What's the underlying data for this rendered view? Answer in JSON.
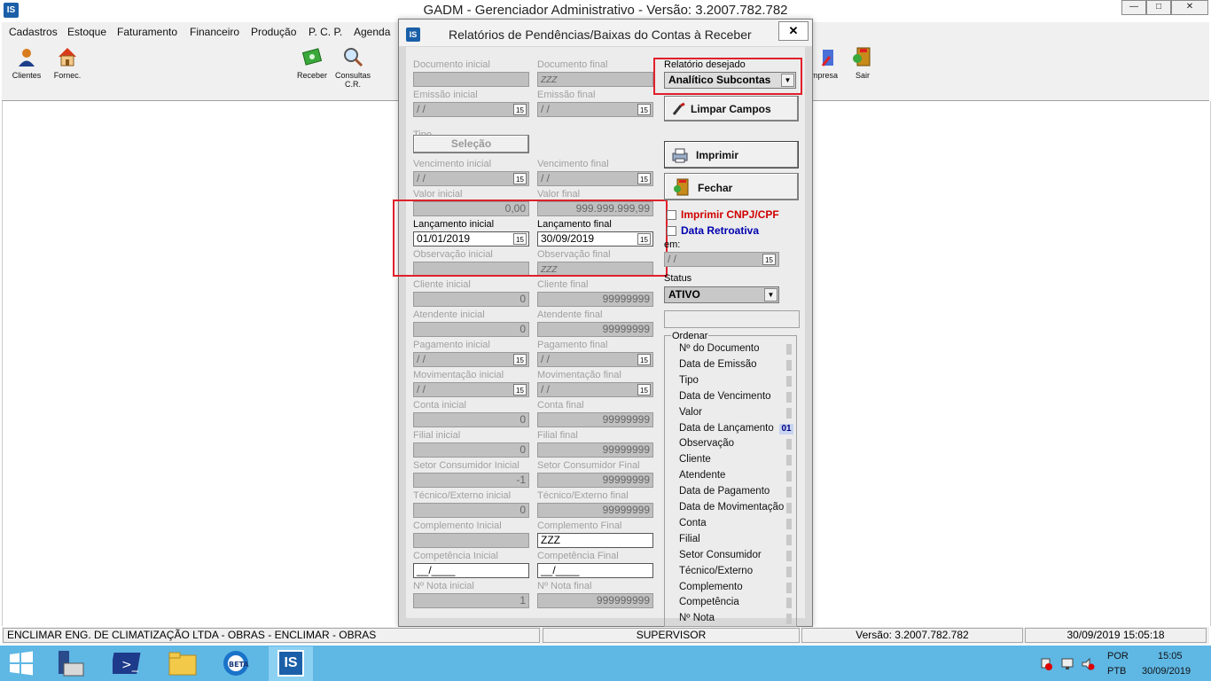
{
  "window": {
    "title": "GADM - Gerenciador Administrativo - Versão: 3.2007.782.782",
    "icon": "is-logo-icon",
    "controls": [
      "minimize-icon",
      "maximize-icon",
      "close-icon"
    ]
  },
  "menu": [
    "Cadastros",
    "Estoque",
    "Faturamento",
    "Financeiro",
    "Produção",
    "P. C. P.",
    "Agenda"
  ],
  "toolbar": [
    {
      "label": "Clientes",
      "icon": "person-icon"
    },
    {
      "label": "Fornec.",
      "icon": "house-icon"
    },
    {
      "label": "Receber",
      "icon": "money-icon"
    },
    {
      "label": "Consultas C.R.",
      "icon": "magnifier-icon"
    },
    {
      "label": "mpresa",
      "icon": "company-icon"
    },
    {
      "label": "Sair",
      "icon": "exit-icon"
    }
  ],
  "dialog": {
    "title": "Relatórios de Pendências/Baixas do Contas à Receber",
    "fields": {
      "doc_ini": {
        "label": "Documento inicial",
        "value": ""
      },
      "doc_fim": {
        "label": "Documento final",
        "value": "ZZZ"
      },
      "emi_ini": {
        "label": "Emissão inicial",
        "value": "/ /"
      },
      "emi_fim": {
        "label": "Emissão final",
        "value": "/ /"
      },
      "tipo": {
        "label": "Tipo",
        "button": "Seleção"
      },
      "venc_ini": {
        "label": "Vencimento inicial",
        "value": "/ /"
      },
      "venc_fim": {
        "label": "Vencimento final",
        "value": "/ /"
      },
      "val_ini": {
        "label": "Valor inicial",
        "value": "0,00"
      },
      "val_fim": {
        "label": "Valor final",
        "value": "999.999.999,99"
      },
      "lanc_ini": {
        "label": "Lançamento inicial",
        "value": "01/01/2019"
      },
      "lanc_fim": {
        "label": "Lançamento final",
        "value": "30/09/2019"
      },
      "obs_ini": {
        "label": "Observação inicial",
        "value": ""
      },
      "obs_fim": {
        "label": "Observação final",
        "value": "ZZZ"
      },
      "cli_ini": {
        "label": "Cliente inicial",
        "value": "0"
      },
      "cli_fim": {
        "label": "Cliente final",
        "value": "99999999"
      },
      "ate_ini": {
        "label": "Atendente inicial",
        "value": "0"
      },
      "ate_fim": {
        "label": "Atendente final",
        "value": "99999999"
      },
      "pag_ini": {
        "label": "Pagamento inicial",
        "value": "/ /"
      },
      "pag_fim": {
        "label": "Pagamento final",
        "value": "/ /"
      },
      "mov_ini": {
        "label": "Movimentação inicial",
        "value": "/ /"
      },
      "mov_fim": {
        "label": "Movimentação final",
        "value": "/ /"
      },
      "con_ini": {
        "label": "Conta inicial",
        "value": "0"
      },
      "con_fim": {
        "label": "Conta final",
        "value": "99999999"
      },
      "fil_ini": {
        "label": "Filial inicial",
        "value": "0"
      },
      "fil_fim": {
        "label": "Filial final",
        "value": "99999999"
      },
      "set_ini": {
        "label": "Setor Consumidor Inicial",
        "value": "-1"
      },
      "set_fim": {
        "label": "Setor Consumidor Final",
        "value": "99999999"
      },
      "tec_ini": {
        "label": "Técnico/Externo inicial",
        "value": "0"
      },
      "tec_fim": {
        "label": "Técnico/Externo final",
        "value": "99999999"
      },
      "comp_ini": {
        "label": "Complemento Inicial",
        "value": ""
      },
      "comp_fim": {
        "label": "Complemento Final",
        "value": "ZZZ"
      },
      "compt_ini": {
        "label": "Competência Inicial",
        "value": "__/____"
      },
      "compt_fim": {
        "label": "Competência Final",
        "value": "__/____"
      },
      "nota_ini": {
        "label": "Nº Nota inicial",
        "value": "1"
      },
      "nota_fim": {
        "label": "Nº Nota final",
        "value": "999999999"
      }
    },
    "report": {
      "label": "Relatório desejado",
      "value": "Analítico Subcontas"
    },
    "buttons": {
      "limpar": "Limpar Campos",
      "imprimir": "Imprimir",
      "fechar": "Fechar"
    },
    "checks": {
      "cnpj": "Imprimir CNPJ/CPF",
      "retro": "Data Retroativa"
    },
    "em": {
      "label": "em:",
      "value": "/ /"
    },
    "status": {
      "label": "Status",
      "value": "ATIVO"
    },
    "ordenar": {
      "label": "Ordenar",
      "items": [
        "Nº do Documento",
        "Data de Emissão",
        "Tipo",
        "Data de Vencimento",
        "Valor",
        "Data de Lançamento",
        "Observação",
        "Cliente",
        "Atendente",
        "Data de Pagamento",
        "Data de Movimentação",
        "Conta",
        "Filial",
        "Setor Consumidor",
        "Técnico/Externo",
        "Complemento",
        "Competência",
        "Nº Nota"
      ],
      "selected_order": "01"
    },
    "cal_glyph": "15"
  },
  "status": {
    "company": "ENCLIMAR ENG. DE CLIMATIZAÇÃO LTDA - OBRAS - ENCLIMAR - OBRAS",
    "user": "SUPERVISOR",
    "version": "Versão: 3.2007.782.782",
    "datetime": "30/09/2019 15:05:18"
  },
  "taskbar": {
    "lang1": "POR",
    "lang2": "PTB",
    "time": "15:05",
    "date": "30/09/2019"
  },
  "colors": {
    "highlight_red": "#e0202a",
    "taskbar": "#5fb7e4",
    "check_red": "#d00000",
    "check_blue": "#0000b0"
  }
}
